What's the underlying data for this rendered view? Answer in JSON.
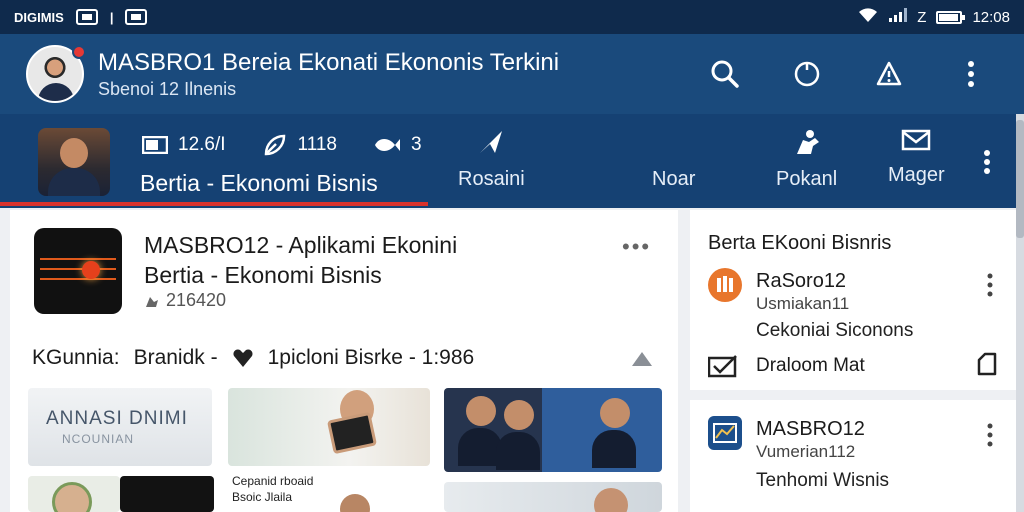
{
  "status_bar": {
    "carrier": "DIGIMIS",
    "time": "12:08",
    "signal_glyph": "Z",
    "icons": [
      "wifi-icon",
      "signal-icon",
      "battery-icon"
    ],
    "battery_level": 0.85
  },
  "app_bar": {
    "title": "MASBRO1 Bereia Ekonati Ekononis Terkini",
    "subtitle": "Sbenoi 12 Ilnenis",
    "has_notification": true
  },
  "tab_bar": {
    "stats": [
      {
        "icon": "image-icon",
        "value": "12.6/I"
      },
      {
        "icon": "like-icon",
        "value": "1118"
      },
      {
        "icon": "fish-icon",
        "value": "3"
      }
    ],
    "active_label": "Bertia - Ekonomi Bisnis",
    "nav": [
      {
        "icon": "share-arrow-icon",
        "label": "Rosaini"
      },
      {
        "icon": "blank-icon",
        "label": "Noar"
      },
      {
        "icon": "person-icon",
        "label": "Pokanl"
      },
      {
        "icon": "mail-icon",
        "label": "Mager"
      }
    ]
  },
  "post": {
    "title": "MASBRO12 - Aplikami Ekonini",
    "subtitle": "Bertia - Ekonomi Bisnis",
    "views": "216420",
    "group_label": "KGunnia:",
    "group_value": "Branidk - ",
    "group_tail": "1picloni Bisrke - 1:986",
    "tiles": {
      "t1_big": "ANNASI DNIMI",
      "t1_small": "NCOUNIAN",
      "t6_cap1": "Cepanid rboaid",
      "t6_cap2": "Bsoic Jlaila"
    }
  },
  "right_panel": {
    "card1": {
      "title": "Berta EKooni Bisnris",
      "item_name": "RaSoro12",
      "item_meta": "Usmiakan11",
      "item_desc": "Cekoniai Siconons",
      "footer_label": "Draloom Mat"
    },
    "card2": {
      "item_name": "MASBRO12",
      "item_meta": "Vumerian112",
      "item_desc": "Tenhomi Wisnis"
    }
  },
  "colors": {
    "status_bar": "#0f2a4c",
    "app_bar": "#1a4a7c",
    "tab_bar": "#154173",
    "accent_underline": "#d9322b",
    "notification": "#e53935",
    "card2_logo": "#1c4f8c",
    "card1_logo": "#e8762c"
  }
}
